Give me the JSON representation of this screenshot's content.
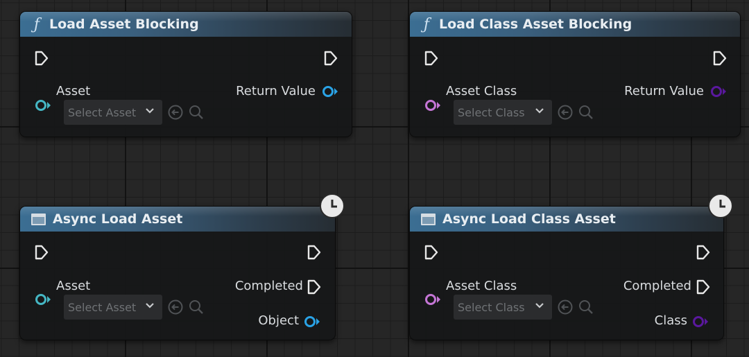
{
  "nodes": {
    "load_asset_blocking": {
      "title": "Load Asset Blocking",
      "input_pin": "Asset",
      "output_pin": "Return Value",
      "selector": "Select Asset"
    },
    "load_class_asset_blocking": {
      "title": "Load Class Asset Blocking",
      "input_pin": "Asset Class",
      "output_pin": "Return Value",
      "selector": "Select Class"
    },
    "async_load_asset": {
      "title": "Async Load Asset",
      "input_pin": "Asset",
      "exec_output": "Completed",
      "output_pin": "Object",
      "selector": "Select Asset"
    },
    "async_load_class_asset": {
      "title": "Async Load Class Asset",
      "input_pin": "Asset Class",
      "exec_output": "Completed",
      "output_pin": "Class",
      "selector": "Select Class"
    }
  },
  "icons": {
    "function": "function-icon",
    "macro": "async-node-icon",
    "latent": "clock-icon",
    "exec": "exec-pin-icon",
    "object_pin": "object-pin-icon",
    "class_pin": "class-pin-icon",
    "use_selected": "use-selected-asset-icon",
    "browse": "browse-magnifier-icon"
  },
  "colors": {
    "object_pin": "#2aa3e6",
    "class_pin_input": "#c576d6",
    "class_pin_output": "#5a189e",
    "object_pin_input": "#45b7c4",
    "header_blue": "#3b6e93"
  }
}
